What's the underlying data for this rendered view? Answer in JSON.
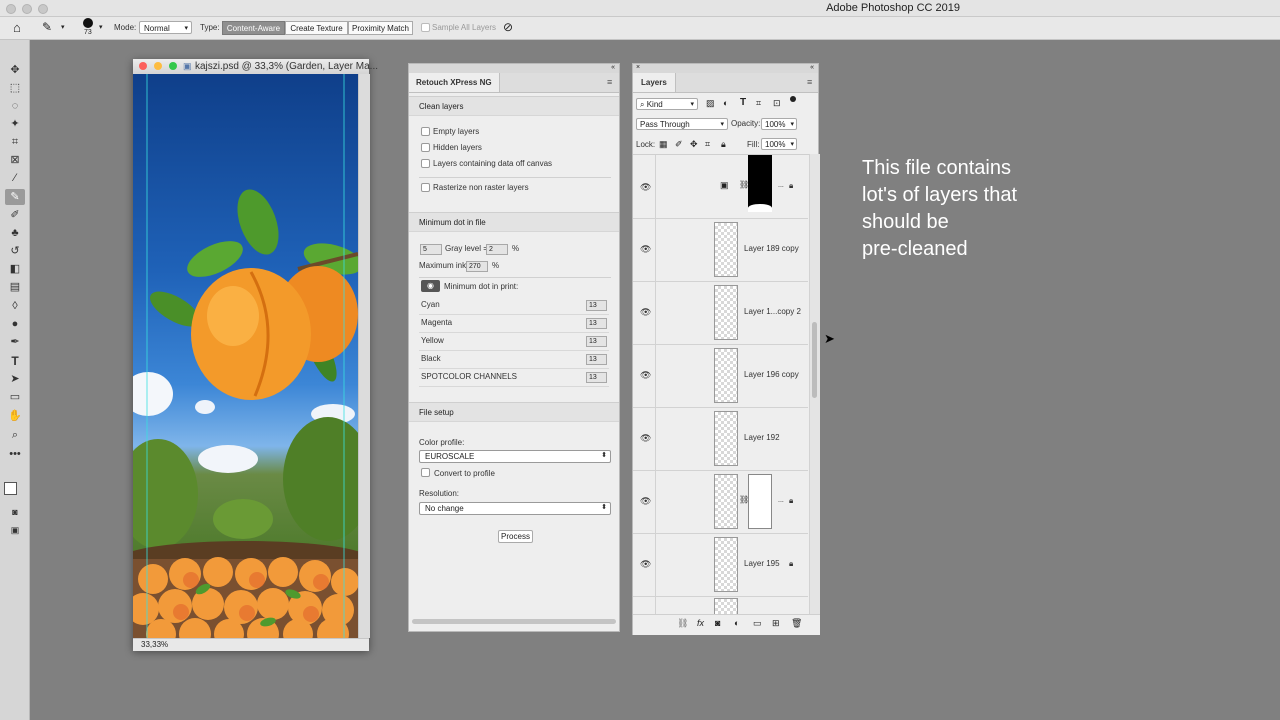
{
  "app": {
    "title": "Adobe Photoshop CC 2019"
  },
  "options_bar": {
    "brush_size": "73",
    "mode_label": "Mode:",
    "mode_value": "Normal",
    "type_label": "Type:",
    "type_options": [
      "Content-Aware",
      "Create Texture",
      "Proximity Match"
    ],
    "sample_all_layers": "Sample All Layers"
  },
  "document": {
    "title": "kajszi.psd @ 33,3% (Garden, Layer Ma...",
    "zoom": "33,33%"
  },
  "retouch_panel": {
    "tab": "Retouch XPress NG",
    "clean_section": "Clean layers",
    "clean_options": [
      "Empty layers",
      "Hidden layers",
      "Layers containing data off canvas"
    ],
    "rasterize": "Rasterize non raster layers",
    "min_dot_section": "Minimum dot in file",
    "dot_value": "5",
    "gray_level_label": "Gray level =",
    "gray_level_value": "2",
    "percent": "%",
    "max_ink_label": "Maximum ink:",
    "max_ink_value": "270",
    "min_dot_print": "Minimum dot in print:",
    "channels": [
      {
        "name": "Cyan",
        "value": "13"
      },
      {
        "name": "Magenta",
        "value": "13"
      },
      {
        "name": "Yellow",
        "value": "13"
      },
      {
        "name": "Black",
        "value": "13"
      },
      {
        "name": "SPOTCOLOR CHANNELS",
        "value": "13"
      }
    ],
    "file_setup_section": "File setup",
    "color_profile_label": "Color profile:",
    "color_profile_value": "EUROSCALE",
    "convert_to_profile": "Convert to profile",
    "resolution_label": "Resolution:",
    "resolution_value": "No change",
    "process_button": "Process"
  },
  "layers_panel": {
    "tab": "Layers",
    "filter_kind": "Kind",
    "blend_mode": "Pass Through",
    "opacity_label": "Opacity:",
    "opacity_value": "100%",
    "lock_label": "Lock:",
    "fill_label": "Fill:",
    "fill_value": "100%",
    "layers": [
      {
        "name": "",
        "visible": true,
        "locked": true
      },
      {
        "name": "Layer 189 copy",
        "visible": true,
        "locked": false
      },
      {
        "name": "Layer 1...copy 2",
        "visible": true,
        "locked": false
      },
      {
        "name": "Layer 196 copy",
        "visible": true,
        "locked": false
      },
      {
        "name": "Layer 192",
        "visible": true,
        "locked": false
      },
      {
        "name": "",
        "visible": true,
        "locked": true
      },
      {
        "name": "Layer 195",
        "visible": true,
        "locked": true
      }
    ]
  },
  "annotation": {
    "lines": [
      "This file contains",
      "lot's of layers that",
      "should be",
      "pre-cleaned"
    ]
  },
  "colors": {
    "background": "#808080",
    "panel": "#eeeeee",
    "toolbar": "#d6d6d6"
  }
}
